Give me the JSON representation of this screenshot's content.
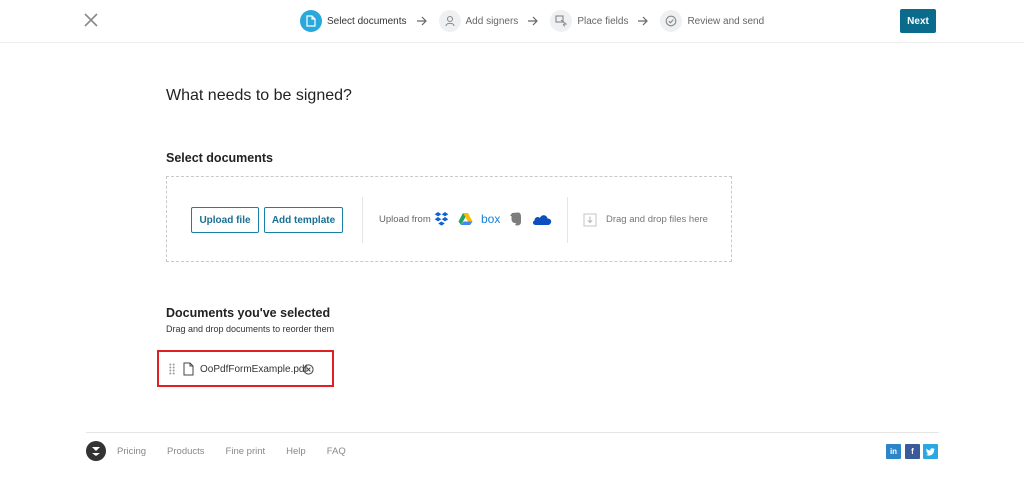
{
  "header": {
    "steps": [
      {
        "label": "Select documents",
        "icon": "document-icon",
        "active": true
      },
      {
        "label": "Add signers",
        "icon": "person-icon",
        "active": false
      },
      {
        "label": "Place fields",
        "icon": "field-cursor-icon",
        "active": false
      },
      {
        "label": "Review and send",
        "icon": "check-circle-icon",
        "active": false
      }
    ],
    "next_label": "Next"
  },
  "main": {
    "title": "What needs to be signed?",
    "select_section": {
      "title": "Select documents",
      "upload_button": "Upload file",
      "template_button": "Add template",
      "upload_from_label": "Upload from",
      "providers": [
        "dropbox-icon",
        "google-drive-icon",
        "box-icon",
        "evernote-icon",
        "onedrive-icon"
      ],
      "drag_label": "Drag and drop files here"
    },
    "selected_section": {
      "title": "Documents you've selected",
      "subtitle": "Drag and drop documents to reorder them",
      "documents": [
        {
          "name": "OoPdfFormExample.pdf"
        }
      ]
    }
  },
  "footer": {
    "links": [
      "Pricing",
      "Products",
      "Fine print",
      "Help",
      "FAQ"
    ],
    "social": [
      "in",
      "f"
    ]
  },
  "colors": {
    "accent": "#29a8dc",
    "primary_button": "#0a6b8c",
    "highlight_border": "#e02020"
  }
}
